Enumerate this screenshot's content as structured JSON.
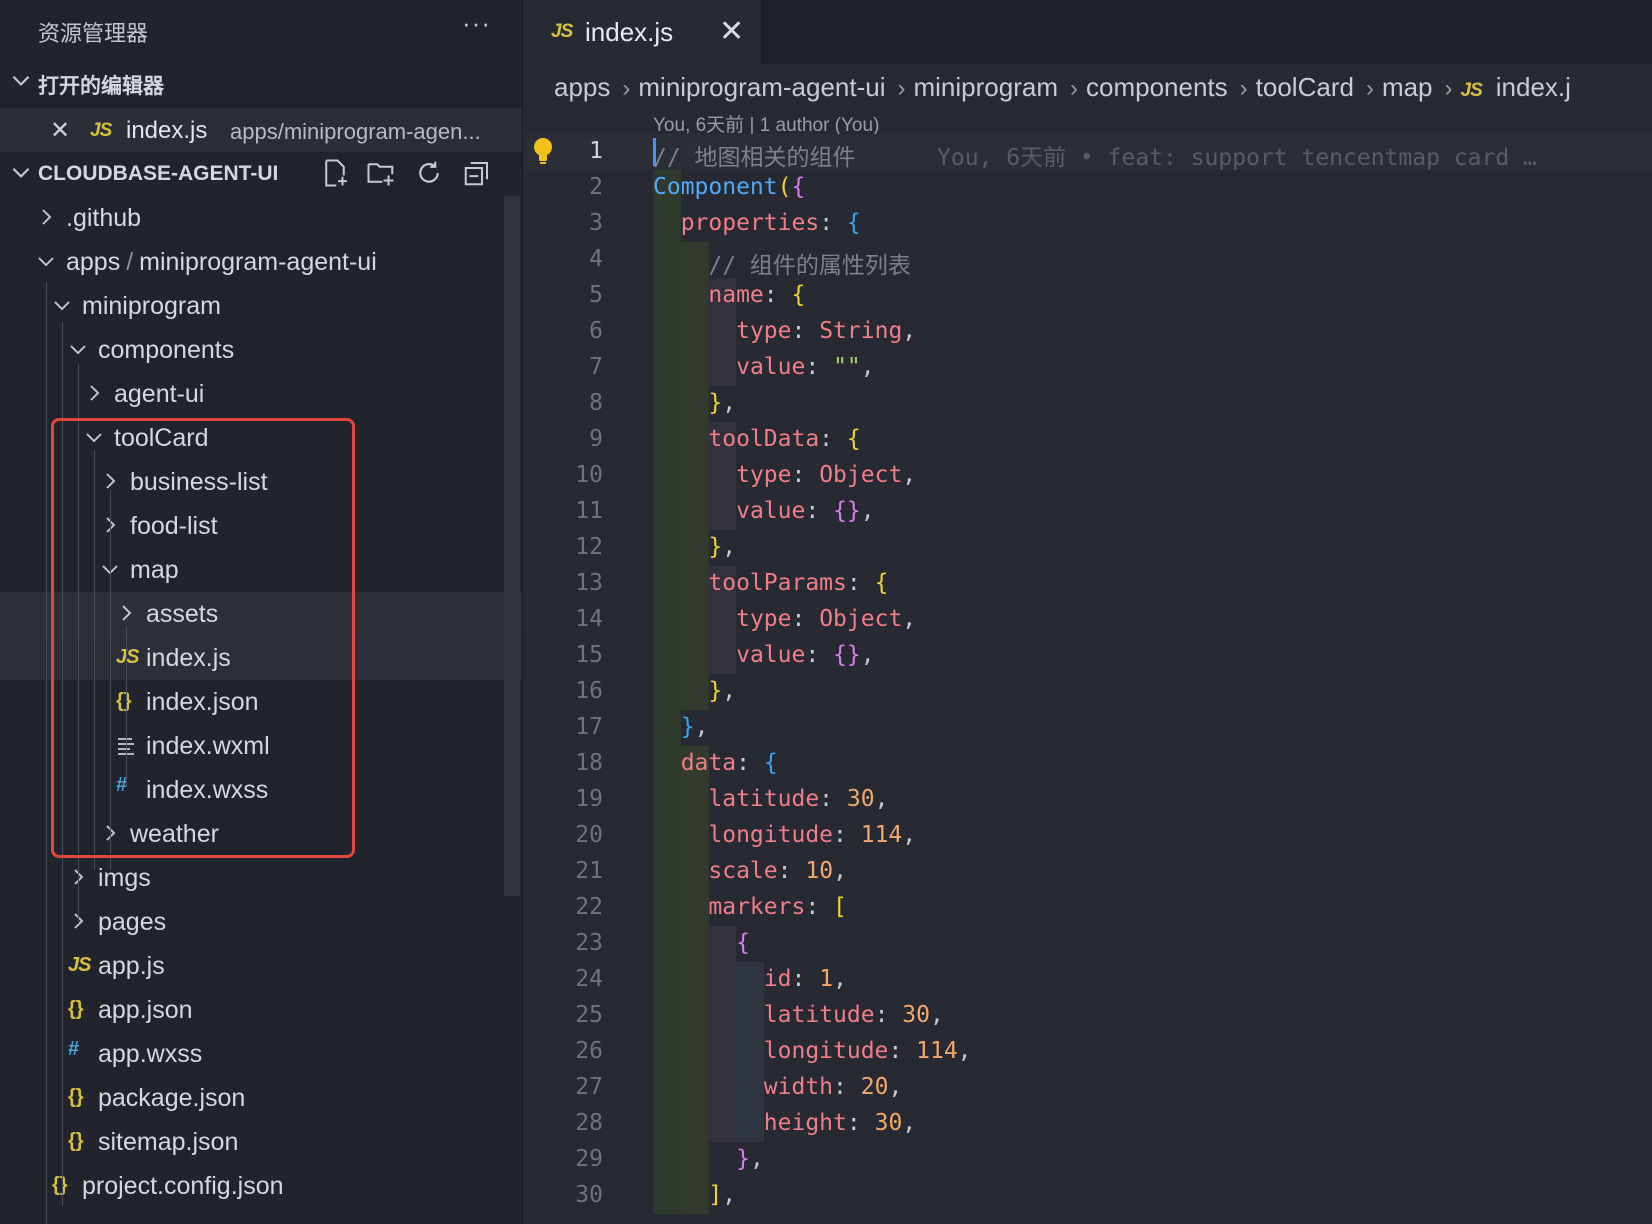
{
  "sidebar": {
    "title": "资源管理器",
    "more": "···",
    "open_editors_label": "打开的编辑器",
    "open_editor": {
      "name": "index.js",
      "path": "apps/miniprogram-agen..."
    },
    "project_label": "CLOUDBASE-AGENT-UI",
    "tree": [
      {
        "label": ".github",
        "kind": "folder-closed",
        "depth": 0
      },
      {
        "label": "apps",
        "label2": "miniprogram-agent-ui",
        "kind": "folder-open",
        "depth": 0
      },
      {
        "label": "miniprogram",
        "kind": "folder-open",
        "depth": 1
      },
      {
        "label": "components",
        "kind": "folder-open",
        "depth": 2
      },
      {
        "label": "agent-ui",
        "kind": "folder-closed",
        "depth": 3
      },
      {
        "label": "toolCard",
        "kind": "folder-open",
        "depth": 3
      },
      {
        "label": "business-list",
        "kind": "folder-closed",
        "depth": 4
      },
      {
        "label": "food-list",
        "kind": "folder-closed",
        "depth": 4
      },
      {
        "label": "map",
        "kind": "folder-open",
        "depth": 4
      },
      {
        "label": "assets",
        "kind": "folder-closed",
        "depth": 5
      },
      {
        "label": "index.js",
        "kind": "js",
        "depth": 5
      },
      {
        "label": "index.json",
        "kind": "json",
        "depth": 5
      },
      {
        "label": "index.wxml",
        "kind": "wxml",
        "depth": 5
      },
      {
        "label": "index.wxss",
        "kind": "wxss",
        "depth": 5
      },
      {
        "label": "weather",
        "kind": "folder-closed",
        "depth": 4
      },
      {
        "label": "imgs",
        "kind": "folder-closed",
        "depth": 2
      },
      {
        "label": "pages",
        "kind": "folder-closed",
        "depth": 2
      },
      {
        "label": "app.js",
        "kind": "js",
        "depth": 2
      },
      {
        "label": "app.json",
        "kind": "json",
        "depth": 2
      },
      {
        "label": "app.wxss",
        "kind": "wxss",
        "depth": 2
      },
      {
        "label": "package.json",
        "kind": "json",
        "depth": 2
      },
      {
        "label": "sitemap.json",
        "kind": "json",
        "depth": 2
      },
      {
        "label": "project.config.json",
        "kind": "json",
        "depth": 1
      }
    ]
  },
  "editor": {
    "tab": {
      "name": "index.js",
      "icon_text": "JS"
    },
    "breadcrumb": [
      "apps",
      "miniprogram-agent-ui",
      "miniprogram",
      "components",
      "toolCard",
      "map",
      "index.j"
    ],
    "blame_header": "You, 6天前 | 1 author (You)",
    "lines": [
      "// 地图相关的组件",
      "Component({",
      "  properties: {",
      "    // 组件的属性列表",
      "    name: {",
      "      type: String,",
      "      value: \"\",",
      "    },",
      "    toolData: {",
      "      type: Object,",
      "      value: {},",
      "    },",
      "    toolParams: {",
      "      type: Object,",
      "      value: {},",
      "    },",
      "  },",
      "  data: {",
      "    latitude: 30,",
      "    longitude: 114,",
      "    scale: 10,",
      "    markers: [",
      "      {",
      "        id: 1,",
      "        latitude: 30,",
      "        longitude: 114,",
      "        width: 20,",
      "        height: 30,",
      "      },",
      "    ],"
    ],
    "inline_blame": "You, 6天前 • feat: support tencentmap card …"
  },
  "colors": {
    "highlight_box": "#e2463c",
    "js_icon": "#d5c13f",
    "wxss_icon": "#4aa3d8"
  }
}
